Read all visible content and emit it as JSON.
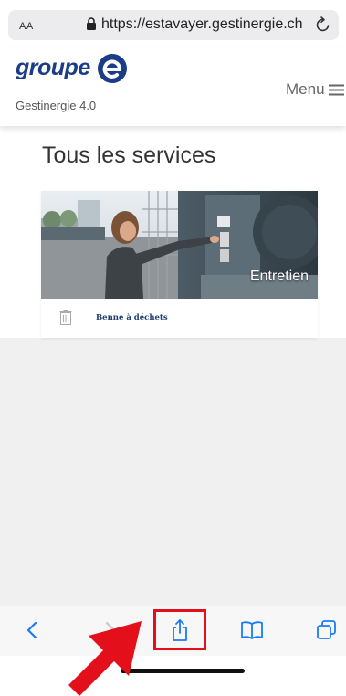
{
  "browser": {
    "text_size_label": "AA",
    "url": "https://estavayer.gestinergie.ch"
  },
  "header": {
    "logo_text": "groupe",
    "app_name": "Gestinergie 4.0",
    "menu_label": "Menu",
    "brand_color": "#1b3c89"
  },
  "main": {
    "title": "Tous les services",
    "card": {
      "image_label": "Entretien",
      "services": [
        {
          "label": "Benne à déchets",
          "icon": "trash-icon"
        }
      ]
    }
  },
  "toolbar": {
    "items": [
      {
        "name": "back",
        "icon": "chevron-left-icon",
        "enabled": true
      },
      {
        "name": "forward",
        "icon": "chevron-right-icon",
        "enabled": false
      },
      {
        "name": "share",
        "icon": "share-icon",
        "enabled": true,
        "highlighted": true
      },
      {
        "name": "bookmarks",
        "icon": "book-icon",
        "enabled": true
      },
      {
        "name": "tabs",
        "icon": "tabs-icon",
        "enabled": true
      }
    ],
    "highlight_color": "#e3101b",
    "accent_color": "#1a7cf5"
  }
}
